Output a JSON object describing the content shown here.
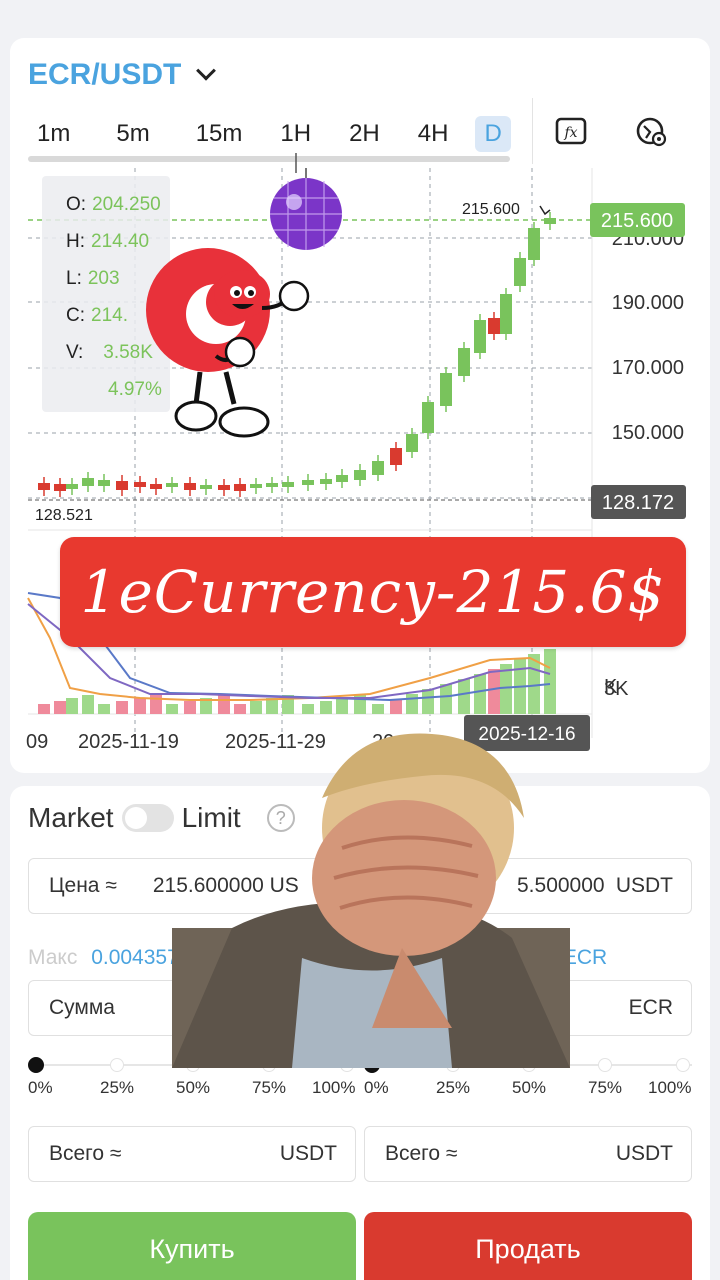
{
  "header": {
    "pair": "ECR/USDT"
  },
  "timeframes": [
    "1m",
    "5m",
    "15m",
    "1H",
    "2H",
    "4H",
    "D"
  ],
  "active_timeframe": "D",
  "ohlc": {
    "o_key": "O:",
    "o_val": "204.250",
    "h_key": "H:",
    "h_val": "214.40",
    "l_key": "L:",
    "l_val": "203",
    "c_key": "C:",
    "c_val": "214.",
    "v_key": "V:",
    "v_val": "3.58K",
    "change": "4.97%"
  },
  "price_axis": [
    "210.000",
    "190.000",
    "170.000",
    "150.000"
  ],
  "current_price_tag": "215.600",
  "high_label": "215.600",
  "low_label": "128.521",
  "crosshair_price": "128.172",
  "volume_axis": [
    "3K"
  ],
  "volume_axis_partial": "K",
  "date_axis": [
    "09",
    "2025-11-19",
    "2025-11-29",
    "20"
  ],
  "crosshair_date": "2025-12-16",
  "banner_text": "1eCurrency-215.6$",
  "colors": {
    "up": "#79c35c",
    "down": "#d93a2f",
    "accent": "#4aa3df",
    "banner": "#e8392f"
  },
  "icons": [
    "chevron-down-icon",
    "fx-indicator-icon",
    "chart-settings-icon",
    "help-icon"
  ],
  "trade": {
    "market_label": "Market",
    "limit_label": "Limit",
    "help": "?",
    "buy_price_label": "Цена ≈",
    "buy_price_value": "215.600000 US",
    "sell_price_value": "5.500000",
    "sell_price_unit": "USDT",
    "max_label": "Макс",
    "buy_max_value": "0.004357",
    "sell_max_value": "935 ECR",
    "amount_label": "Сумма",
    "amount_unit": "ECR",
    "percent": [
      "0%",
      "25%",
      "50%",
      "75%",
      "100%"
    ],
    "buy_pct_level": 0,
    "sell_pct_level": 0,
    "total_label": "Всего ≈",
    "total_unit": "USDT",
    "buy_button": "Купить",
    "sell_button": "Продать"
  }
}
